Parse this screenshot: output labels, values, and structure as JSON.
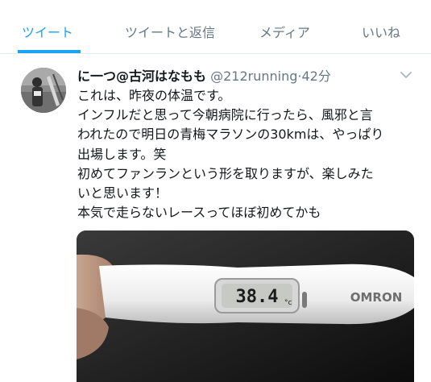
{
  "tabs": [
    {
      "label": "ツイート",
      "active": true
    },
    {
      "label": "ツイートと返信",
      "active": false
    },
    {
      "label": "メディア",
      "active": false
    },
    {
      "label": "いいね",
      "active": false
    }
  ],
  "tweet": {
    "name": "に一つ@古河はなもも",
    "handle": "@212running",
    "separator": "·",
    "time": "42分",
    "text_lines": [
      "これは、昨夜の体温です。",
      "インフルだと思って今朝病院に行ったら、風邪と言",
      "われたので明日の青梅マラソンの30kmは、やっぱり",
      "出場します。笑",
      "初めてファンランという形を取りますが、楽しみた",
      "いと思います！",
      "本気で走らないレースってほぼ初めてかも"
    ],
    "thermometer": {
      "reading": "38.4",
      "unit": "°c",
      "brand": "OMRON"
    }
  },
  "colors": {
    "accent": "#1da1f2",
    "secondary_text": "#657786",
    "primary_text": "#14171a",
    "divider": "#e6ecf0"
  }
}
